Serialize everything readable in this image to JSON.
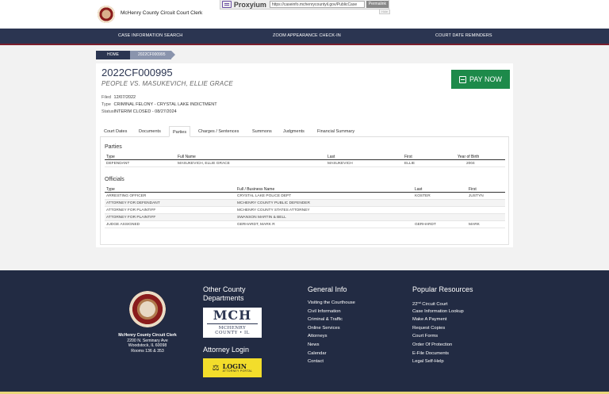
{
  "header": {
    "clerk_title": "McHenry County Circuit Court Clerk",
    "proxy_name": "Proxyium",
    "proxy_url": "https://caseinfo.mchenrycountyil.gov/PublicCase",
    "permalink_label": "Permalink",
    "proxy_tab": "Hide"
  },
  "nav": {
    "items": [
      "CASE INFORMATION SEARCH",
      "ZOOM APPEARANCE CHECK-IN",
      "COURT DATE REMINDERS"
    ]
  },
  "breadcrumb": {
    "home": "HOME",
    "current": "2022CF000995"
  },
  "case": {
    "number": "2022CF000995",
    "caption": "PEOPLE VS. MASUKEVICH, ELLIE GRACE",
    "pay_label": "PAY NOW",
    "filed_label": "Filed",
    "filed_value": "12/07/2022",
    "type_label": "Type",
    "type_value": "CRIMINAL FELONY - CRYSTAL LAKE INDICTMENT",
    "status_label": "Status",
    "status_value": "INTERIM CLOSED - 08/27/2024"
  },
  "tabs": [
    "Court Dates",
    "Documents",
    "Parties",
    "Charges / Sentences",
    "Summons",
    "Judgments",
    "Financial Summary"
  ],
  "active_tab": "Parties",
  "parties": {
    "heading": "Parties",
    "headers": [
      "Type",
      "Full Name",
      "Last",
      "First",
      "Year of Birth"
    ],
    "rows": [
      [
        "DEFENDANT",
        "MASUKEVICH, ELLIE GRACE",
        "MASUKEVICH",
        "ELLIE",
        "2004"
      ]
    ]
  },
  "officials": {
    "heading": "Officials",
    "headers": [
      "Type",
      "Full / Business Name",
      "Last",
      "First"
    ],
    "rows": [
      [
        "ARRESTING OFFICER",
        "CRYSTAL LAKE POLICE DEPT",
        "KOSTER",
        "JUSTYN"
      ],
      [
        "ATTORNEY FOR DEFENDANT",
        "MCHENRY COUNTY PUBLIC DEFENDER",
        "",
        ""
      ],
      [
        "ATTORNEY FOR PLAINTIFF",
        "MCHENRY COUNTY STATES ATTORNEY",
        "",
        ""
      ],
      [
        "ATTORNEY FOR PLAINTIFF",
        "SWANSON MARTIN & BELL",
        "",
        ""
      ],
      [
        "JUDGE ASSIGNED",
        "GERHARDT, MARK R",
        "GERHARDT",
        "MARK"
      ]
    ]
  },
  "footer": {
    "clerk_name": "McHenry County Circuit Clerk",
    "address1": "2200 N. Seminary Ave",
    "address2": "Woodstock, IL 60098",
    "address3": "Rooms 136 & 353",
    "other_heading": "Other County Departments",
    "mch_letters": "MCH",
    "mch_sub": "MCHENRY COUNTY • IL",
    "attorney_heading": "Attorney Login",
    "login_title": "LOGIN",
    "login_sub": "ATTORNEY PORTAL",
    "general_heading": "General Info",
    "general_links": [
      "Visiting the Courthouse",
      "Civil Information",
      "Criminal & Traffic",
      "Online Services",
      "Attorneys",
      "News",
      "Calendar",
      "Contact"
    ],
    "popular_heading": "Popular Resources",
    "popular_first_num": "22",
    "popular_first_sup": "nd",
    "popular_first_rest": " Circuit Court",
    "popular_links": [
      "Case Information Lookup",
      "Make A Payment",
      "Request Copies",
      "Court Forms",
      "Order Of Protection",
      "E-File Documents",
      "Legal Self-Help"
    ]
  },
  "colors": {
    "navy": "#2b3551",
    "pay_green": "#1d8a4a",
    "footer_bg": "#222b43",
    "accent_yellow": "#f3dd2b"
  }
}
